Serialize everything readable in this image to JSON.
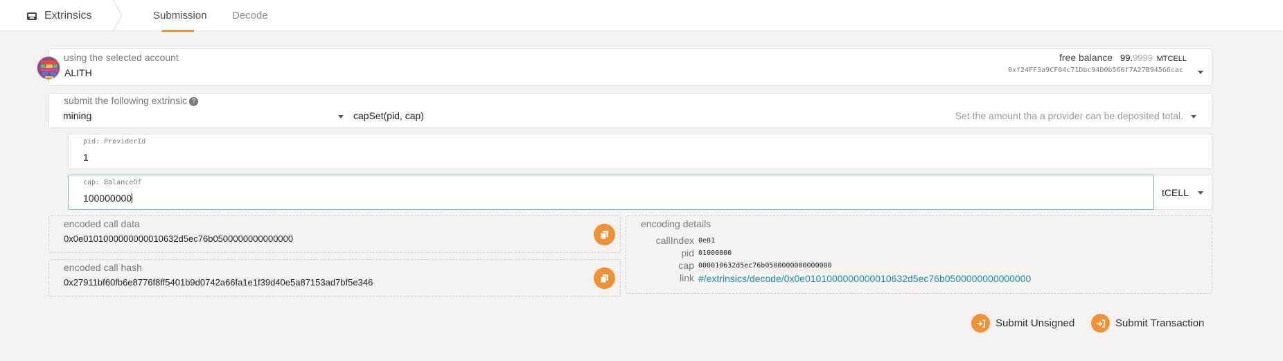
{
  "nav": {
    "app_label": "Extrinsics",
    "tabs": [
      {
        "label": "Submission",
        "active": true
      },
      {
        "label": "Decode",
        "active": false
      }
    ]
  },
  "account": {
    "label": "using the selected account",
    "name": "ALITH",
    "balance_label": "free balance",
    "balance_int": "99.",
    "balance_frac": "9999",
    "balance_unit": "MTCELL",
    "address": "0xf24FF3a9CF04c71Dbc94D0b566f7A27B94566cac"
  },
  "extrinsic": {
    "label": "submit the following extrinsic",
    "help_glyph": "?",
    "section": "mining",
    "method": "capSet(pid, cap)",
    "description": "Set the amount tha a provider can be deposited total."
  },
  "params": {
    "pid_label": "pid: ProviderId",
    "pid_value": "1",
    "cap_label": "cap: BalanceOf",
    "cap_value": "100000000",
    "cap_unit": "tCELL"
  },
  "encoded": {
    "call_data_label": "encoded call data",
    "call_data": "0x0e0101000000000010632d5ec76b0500000000000000",
    "call_hash_label": "encoded call hash",
    "call_hash": "0x27911bf60fb6e8776f8ff5401b9d0742a66fa1e1f39d40e5a87153ad7bf5e346"
  },
  "details": {
    "title": "encoding details",
    "rows": [
      {
        "key": "callIndex",
        "value": "0e01"
      },
      {
        "key": "pid",
        "value": "01000000"
      },
      {
        "key": "cap",
        "value": "000010632d5ec76b0500000000000000"
      }
    ],
    "link_key": "link",
    "link_value": "#/extrinsics/decode/0x0e0101000000000010632d5ec76b0500000000000000"
  },
  "actions": {
    "submit_unsigned": "Submit Unsigned",
    "submit_transaction": "Submit Transaction"
  },
  "colors": {
    "accent": "#f19135",
    "link": "#1a8fa3",
    "background": "#f3f2f0"
  }
}
